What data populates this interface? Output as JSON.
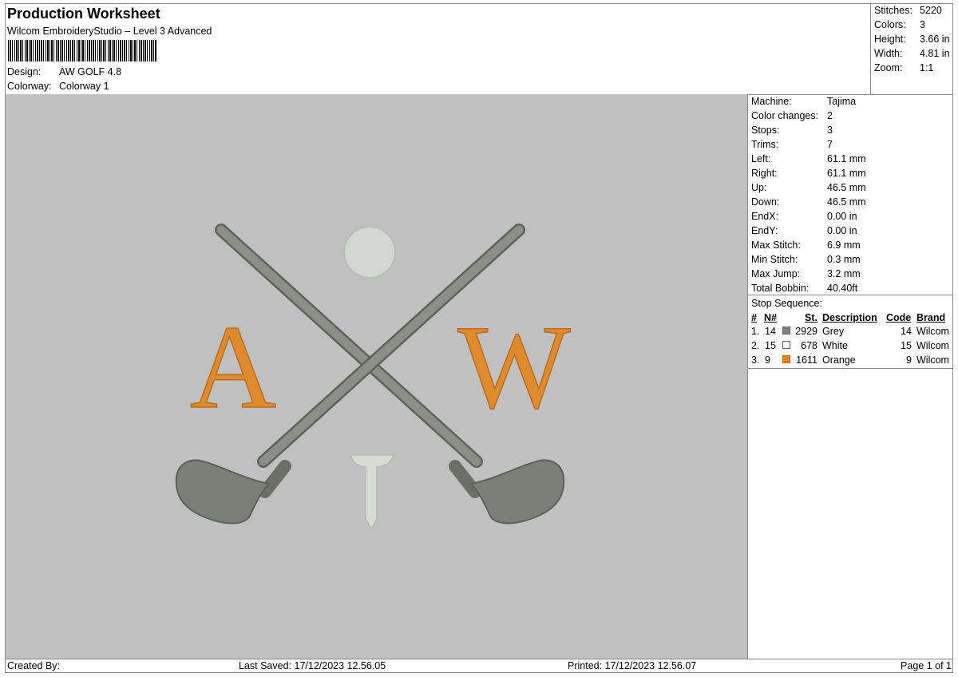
{
  "header": {
    "title": "Production Worksheet",
    "software": "Wilcom EmbroideryStudio – Level 3 Advanced",
    "design_label": "Design:",
    "design_value": "AW GOLF 4.8",
    "colorway_label": "Colorway:",
    "colorway_value": "Colorway 1"
  },
  "summary": [
    {
      "label": "Stitches:",
      "value": "5220"
    },
    {
      "label": "Colors:",
      "value": "3"
    },
    {
      "label": "Height:",
      "value": "3.66 in"
    },
    {
      "label": "Width:",
      "value": "4.81 in"
    },
    {
      "label": "Zoom:",
      "value": "1:1"
    }
  ],
  "machine_info": [
    {
      "label": "Machine:",
      "value": "Tajima"
    },
    {
      "label": "Color changes:",
      "value": "2"
    },
    {
      "label": "Stops:",
      "value": "3"
    },
    {
      "label": "Trims:",
      "value": "7"
    },
    {
      "label": "Left:",
      "value": "61.1 mm"
    },
    {
      "label": "Right:",
      "value": "61.1 mm"
    },
    {
      "label": "Up:",
      "value": "46.5 mm"
    },
    {
      "label": "Down:",
      "value": "46.5 mm"
    },
    {
      "label": "EndX:",
      "value": "0.00 in"
    },
    {
      "label": "EndY:",
      "value": "0.00 in"
    },
    {
      "label": "Max Stitch:",
      "value": "6.9 mm"
    },
    {
      "label": "Min Stitch:",
      "value": "0.3 mm"
    },
    {
      "label": "Max Jump:",
      "value": "3.2 mm"
    },
    {
      "label": "Total Bobbin:",
      "value": "40.40ft"
    }
  ],
  "stop_sequence": {
    "title": "Stop Sequence:",
    "headers": {
      "num": "#",
      "n": "N#",
      "st": "St.",
      "description": "Description",
      "code": "Code",
      "brand": "Brand"
    },
    "rows": [
      {
        "num": "1.",
        "n": "14",
        "st": "2929",
        "description": "Grey",
        "code": "14",
        "brand": "Wilcom",
        "color": "#808080"
      },
      {
        "num": "2.",
        "n": "15",
        "st": "678",
        "description": "White",
        "code": "15",
        "brand": "Wilcom",
        "color": "#ffffff"
      },
      {
        "num": "3.",
        "n": "9",
        "st": "1611",
        "description": "Orange",
        "code": "9",
        "brand": "Wilcom",
        "color": "#e8841a"
      }
    ]
  },
  "design_art": {
    "letter_left": "A",
    "letter_right": "W",
    "colors": {
      "background": "#c0c0c0",
      "club": "#7f837b",
      "ball": "#d4d6d1",
      "tee": "#d8dad4",
      "letters": "#e08a2e"
    }
  },
  "footer": {
    "created_by": "Created By:",
    "last_saved": "Last Saved: 17/12/2023 12.56.05",
    "printed": "Printed: 17/12/2023 12.56.07",
    "page": "Page 1 of 1"
  }
}
